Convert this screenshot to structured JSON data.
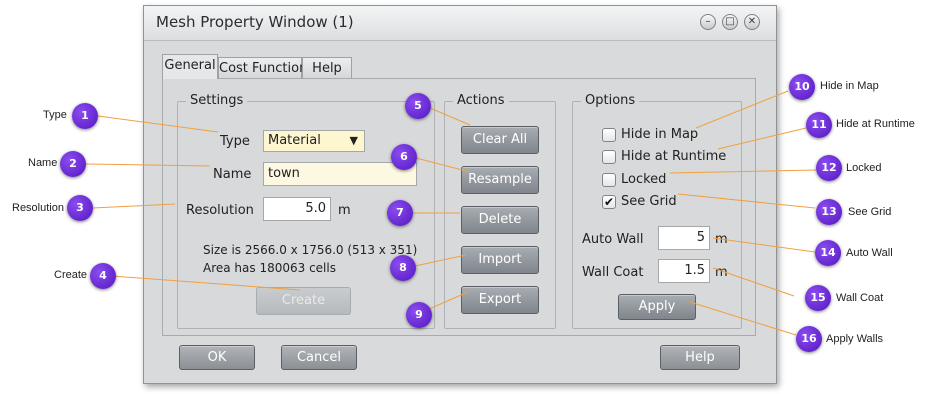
{
  "window": {
    "title": "Mesh Property Window (1)",
    "controls": {
      "minimize": "–",
      "maximize": "□",
      "close": "✕"
    }
  },
  "tabs": [
    {
      "label": "General",
      "active": true
    },
    {
      "label": "Cost Function",
      "active": false
    },
    {
      "label": "Help",
      "active": false
    }
  ],
  "settings": {
    "title": "Settings",
    "type_label": "Type",
    "type_value": "Material",
    "name_label": "Name",
    "name_value": "town",
    "resolution_label": "Resolution",
    "resolution_value": "5.0",
    "resolution_unit": "m",
    "size_text": "Size is 2566.0 x 1756.0 (513 x 351)",
    "area_text": "Area has 180063 cells",
    "create_label": "Create"
  },
  "actions": {
    "title": "Actions",
    "clear_all": "Clear All",
    "resample": "Resample",
    "delete": "Delete",
    "import": "Import",
    "export": "Export"
  },
  "options": {
    "title": "Options",
    "hide_in_map": {
      "label": "Hide in Map",
      "checked": false
    },
    "hide_at_runtime": {
      "label": "Hide at Runtime",
      "checked": false
    },
    "locked": {
      "label": "Locked",
      "checked": false
    },
    "see_grid": {
      "label": "See Grid",
      "checked": true
    },
    "auto_wall_label": "Auto Wall",
    "auto_wall_value": "5",
    "auto_wall_unit": "m",
    "wall_coat_label": "Wall Coat",
    "wall_coat_value": "1.5",
    "wall_coat_unit": "m",
    "apply_label": "Apply"
  },
  "footer": {
    "ok": "OK",
    "cancel": "Cancel",
    "help": "Help"
  },
  "callouts": [
    {
      "num": "1",
      "text": "Type"
    },
    {
      "num": "2",
      "text": "Name"
    },
    {
      "num": "3",
      "text": "Resolution"
    },
    {
      "num": "4",
      "text": "Create"
    },
    {
      "num": "5",
      "text": ""
    },
    {
      "num": "6",
      "text": ""
    },
    {
      "num": "7",
      "text": ""
    },
    {
      "num": "8",
      "text": ""
    },
    {
      "num": "9",
      "text": ""
    },
    {
      "num": "10",
      "text": "Hide in Map"
    },
    {
      "num": "11",
      "text": "Hide at Runtime"
    },
    {
      "num": "12",
      "text": "Locked"
    },
    {
      "num": "13",
      "text": "See Grid"
    },
    {
      "num": "14",
      "text": "Auto Wall"
    },
    {
      "num": "15",
      "text": "Wall Coat"
    },
    {
      "num": "16",
      "text": "Apply Walls"
    }
  ],
  "colors": {
    "callout_badge": "#5b1dc8",
    "callout_line": "#f0a040",
    "window_bg": "#d9dadb",
    "button_bg": "#8f959a",
    "select_bg": "#fdf6cf"
  },
  "icons": {
    "checkmark": "check-icon",
    "dropdown": "chevron-down-icon"
  }
}
